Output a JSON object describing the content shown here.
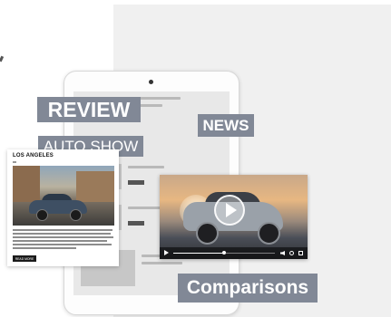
{
  "labels": {
    "review": "REVIEW",
    "auto_show": "AUTO SHOW",
    "news": "NEWS",
    "comparisons": "Comparisons"
  },
  "article_card": {
    "title": "LOS ANGELES",
    "read_more": "READ MORE"
  },
  "video_player": {
    "progress": 0.5,
    "icons": [
      "play-icon",
      "volume-icon",
      "settings-icon",
      "fullscreen-icon"
    ]
  },
  "colors": {
    "label_background": "#818896",
    "label_text": "#ffffff",
    "panel_background": "#f0f0f0"
  }
}
